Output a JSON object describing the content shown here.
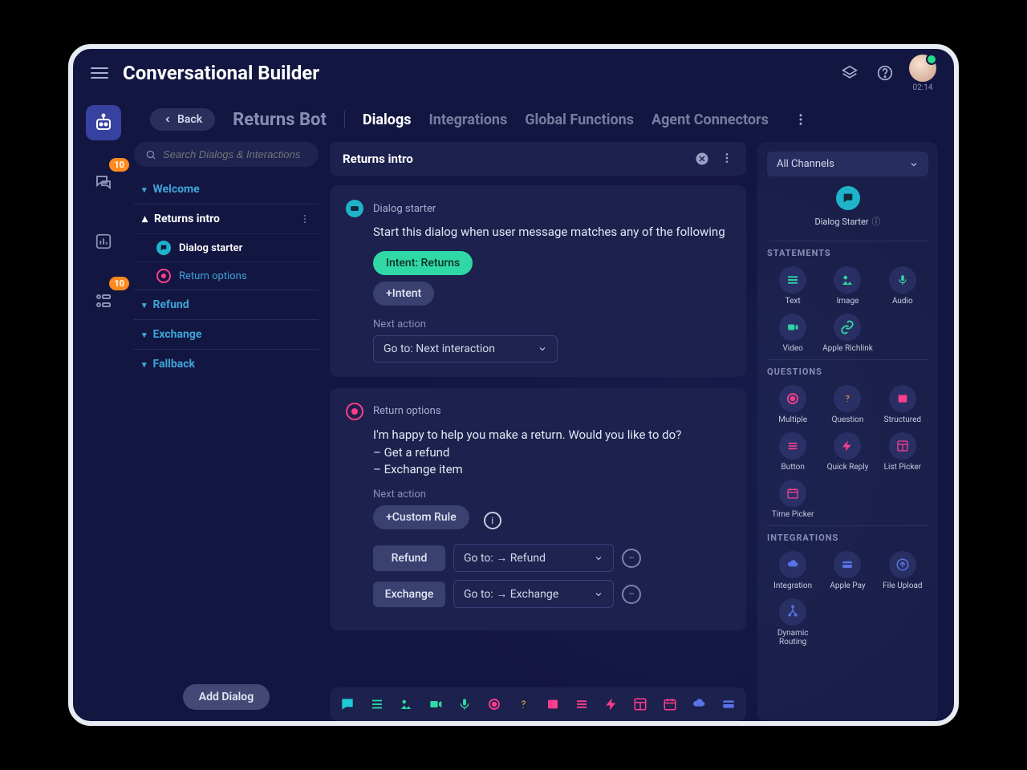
{
  "app_title": "Conversational Builder",
  "timer": "02:14",
  "leftrail": {
    "badge1": "10",
    "badge2": "10"
  },
  "subheader": {
    "back": "Back",
    "page_title": "Returns Bot",
    "tabs": [
      "Dialogs",
      "Integrations",
      "Global Functions",
      "Agent Connectors"
    ],
    "active_tab": 0
  },
  "search_placeholder": "Search Dialogs & Interactions",
  "dialogs": {
    "items": [
      "Welcome",
      "Returns intro",
      "Refund",
      "Exchange",
      "Fallback"
    ],
    "expanded": "Returns intro",
    "sub_items": [
      "Dialog starter",
      "Return options"
    ]
  },
  "add_dialog": "Add Dialog",
  "canvas": {
    "title": "Returns intro",
    "card1": {
      "label": "Dialog starter",
      "body": "Start this dialog when user message matches any of the following",
      "chip_intent": "Intent: Returns",
      "chip_add": "+Intent",
      "next_label": "Next action",
      "next_value": "Go to: Next interaction"
    },
    "card2": {
      "label": "Return options",
      "body": "I'm happy to help you make a return. Would you like to do?\n– Get a refund\n– Exchange item",
      "next_label": "Next action",
      "custom_rule": "+Custom Rule",
      "rule1_label": "Refund",
      "rule1_value": "Go to: → Refund",
      "rule2_label": "Exchange",
      "rule2_value": "Go to: → Exchange"
    }
  },
  "palette": {
    "channels": "All Channels",
    "hero": "Dialog Starter",
    "sections": {
      "statements_label": "STATEMENTS",
      "statements": [
        "Text",
        "Image",
        "Audio",
        "Video",
        "Apple Richlink"
      ],
      "questions_label": "QUESTIONS",
      "questions": [
        "Multiple",
        "Question",
        "Structured",
        "Button",
        "Quick Reply",
        "List Picker",
        "Time Picker"
      ],
      "integrations_label": "INTEGRATIONS",
      "integrations": [
        "Integration",
        "Apple Pay",
        "File Upload",
        "Dynamic Routing"
      ]
    }
  }
}
